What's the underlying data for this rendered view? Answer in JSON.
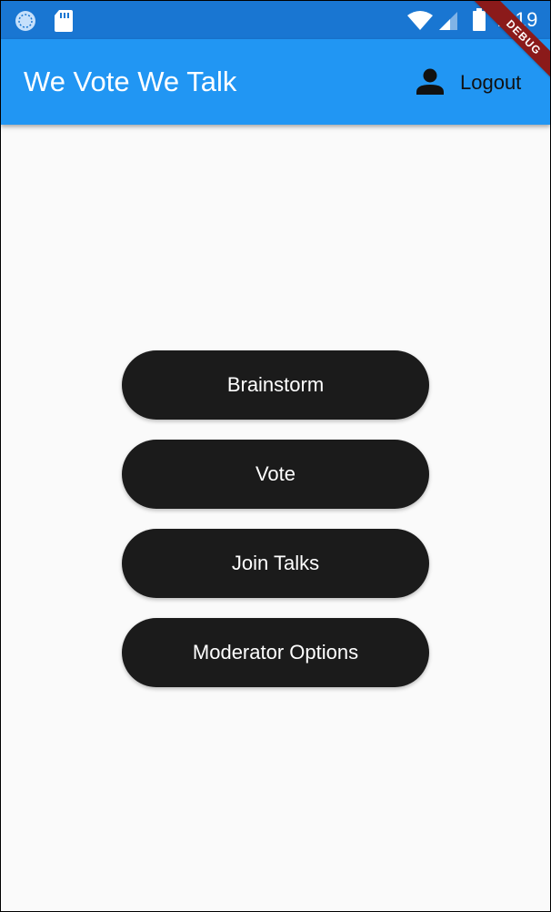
{
  "status_bar": {
    "time": "2:19",
    "icons": [
      "sync-icon",
      "sd-card-icon",
      "wifi-icon",
      "signal-icon",
      "battery-icon"
    ]
  },
  "app_bar": {
    "title": "We Vote We Talk",
    "logout_label": "Logout",
    "debug_banner": "DEBUG"
  },
  "menu": {
    "buttons": [
      {
        "label": "Brainstorm"
      },
      {
        "label": "Vote"
      },
      {
        "label": "Join Talks"
      },
      {
        "label": "Moderator Options"
      }
    ]
  },
  "colors": {
    "status_bar": "#1976d2",
    "app_bar": "#2196f3",
    "button_bg": "#1b1b1b",
    "page_bg": "#fafafa"
  }
}
